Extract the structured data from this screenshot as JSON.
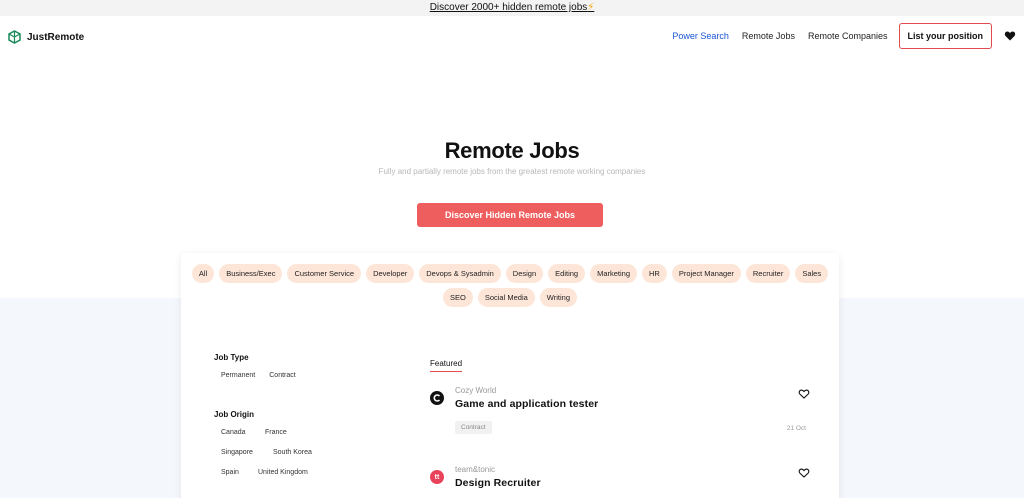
{
  "topbar": {
    "text": "Discover 2000+ hidden remote jobs",
    "emoji": "⚡"
  },
  "nav": {
    "brand": "JustRemote",
    "links": [
      "Power Search",
      "Remote Jobs",
      "Remote Companies"
    ],
    "cta": "List your position",
    "heart_icon": "heart-icon"
  },
  "hero": {
    "title": "Remote Jobs",
    "subtitle": "Fully and partially remote jobs from the greatest remote working companies",
    "cta": "Discover Hidden Remote Jobs"
  },
  "categories": [
    "All",
    "Business/Exec",
    "Customer Service",
    "Developer",
    "Devops & Sysadmin",
    "Design",
    "Editing",
    "Marketing",
    "HR",
    "Project Manager",
    "Recruiter",
    "Sales",
    "SEO",
    "Social Media",
    "Writing"
  ],
  "filters": {
    "job_type": {
      "title": "Job Type",
      "options": [
        "Permanent",
        "Contract"
      ]
    },
    "job_origin": {
      "title": "Job Origin",
      "options": [
        "Canada",
        "France",
        "Singapore",
        "South Korea",
        "Spain",
        "United Kingdom"
      ]
    }
  },
  "listing": {
    "tab": "Featured",
    "jobs": [
      {
        "company": "Cozy World",
        "title": "Game and application tester",
        "tag": "Contract",
        "date": "21 Oct",
        "logo_text": "C",
        "logo_color": "#111111"
      },
      {
        "company": "team&tonic",
        "title": "Design Recruiter",
        "tag": "",
        "date": "",
        "logo_text": "tt",
        "logo_color": "#e8435a"
      }
    ]
  },
  "colors": {
    "accent": "#ee5e5e",
    "link_active": "#1a55d6",
    "chip_bg": "#fde6d8"
  }
}
